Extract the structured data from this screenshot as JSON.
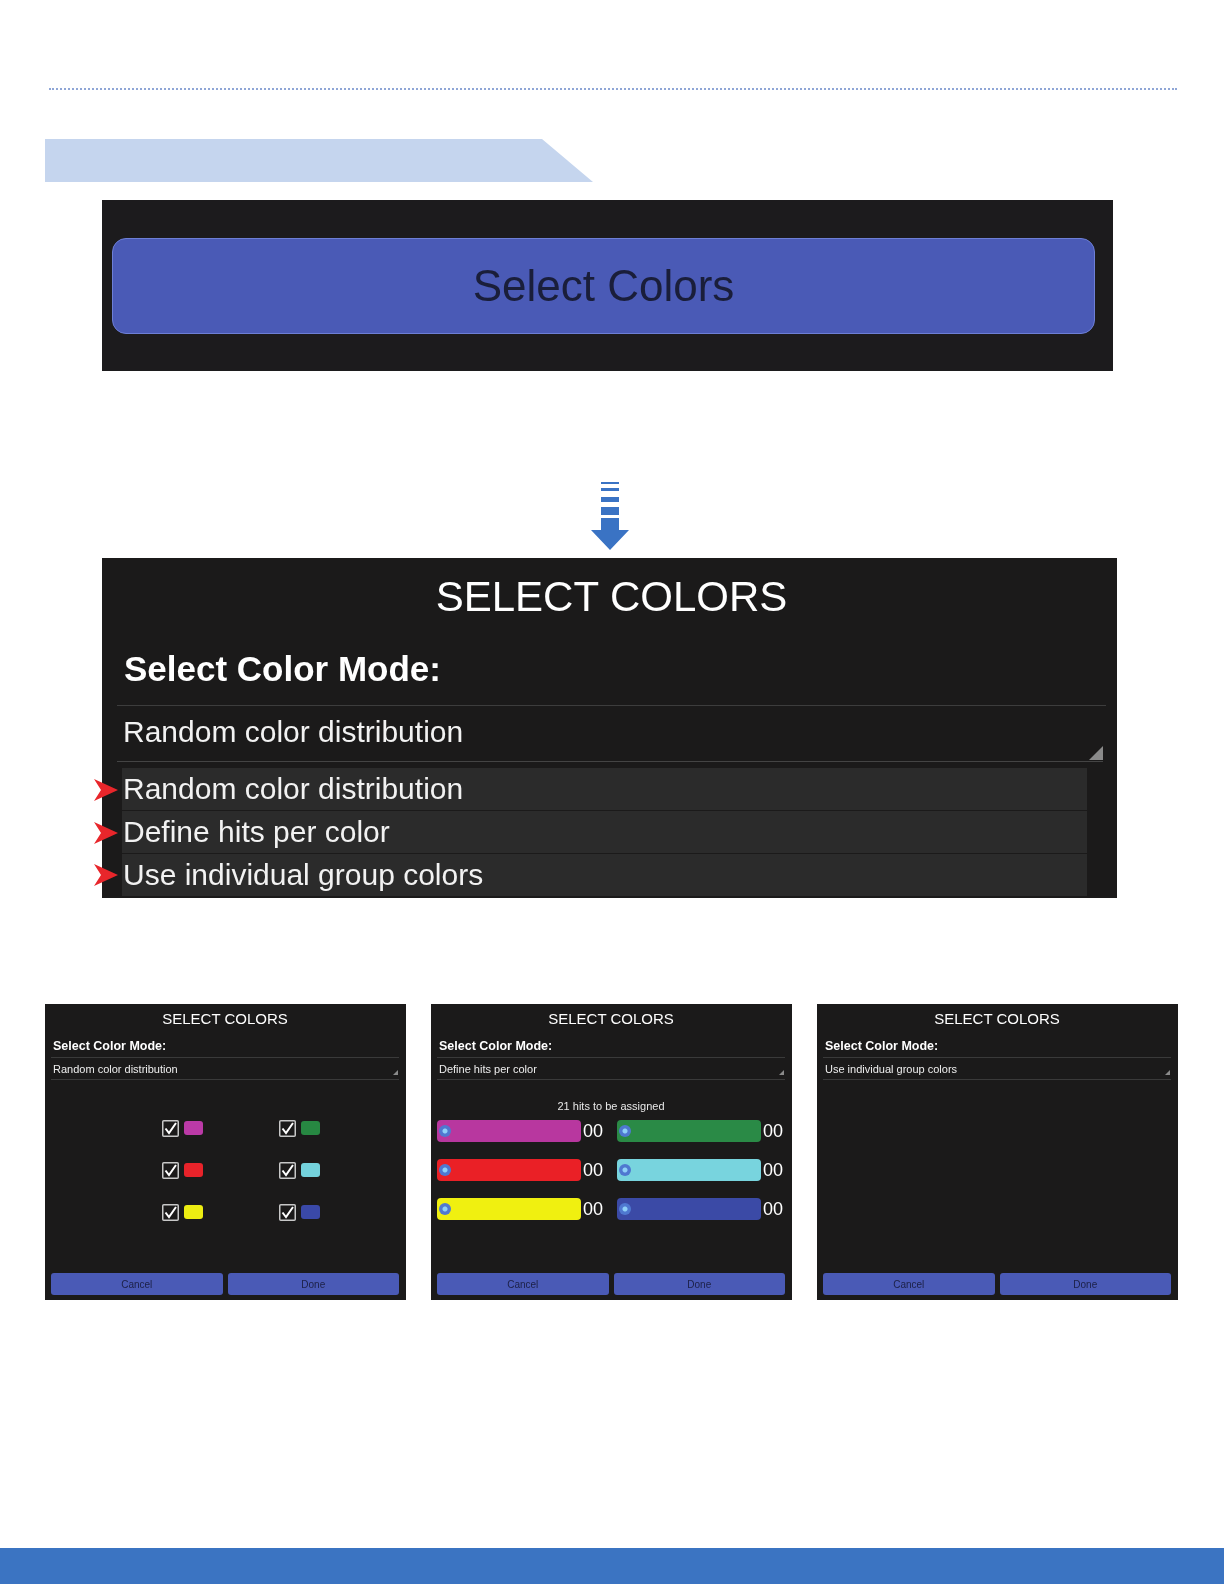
{
  "button_preview": {
    "label": "Select Colors"
  },
  "dialog_preview": {
    "title": "SELECT COLORS",
    "mode_label": "Select Color Mode:",
    "mode_value": "Random color distribution",
    "options": [
      {
        "label": "Random color distribution"
      },
      {
        "label": "Define hits per color"
      },
      {
        "label": "Use individual group colors"
      }
    ]
  },
  "mode_screens": [
    {
      "kind": "checkboxes",
      "title": "SELECT COLORS",
      "mode_label": "Select Color Mode:",
      "mode_value": "Random color distribution",
      "colors": [
        {
          "color": "#bb3aa7",
          "checked": true
        },
        {
          "color": "#278842",
          "checked": true
        },
        {
          "color": "#e8232a",
          "checked": true
        },
        {
          "color": "#74d2dc",
          "checked": true
        },
        {
          "color": "#eded12",
          "checked": true
        },
        {
          "color": "#3a49a8",
          "checked": true
        }
      ],
      "buttons": [
        "Cancel",
        "Done"
      ]
    },
    {
      "kind": "sliders",
      "title": "SELECT COLORS",
      "mode_label": "Select Color Mode:",
      "mode_value": "Define hits per color",
      "hint": "21 hits to be assigned",
      "sliders": [
        {
          "color": "#b8379f",
          "level": 0,
          "reading": "00"
        },
        {
          "color": "#2a8a46",
          "level": 0,
          "reading": "00"
        },
        {
          "color": "#ea2026",
          "level": 0,
          "reading": "00"
        },
        {
          "color": "#78d4de",
          "level": 0,
          "reading": "00"
        },
        {
          "color": "#f0f010",
          "level": 0,
          "reading": "00"
        },
        {
          "color": "#3b4aa6",
          "level": 0,
          "reading": "00"
        }
      ],
      "buttons": [
        "Cancel",
        "Done"
      ]
    },
    {
      "kind": "empty",
      "title": "SELECT COLORS",
      "mode_label": "Select Color Mode:",
      "mode_value": "Use individual group colors",
      "buttons": [
        "Cancel",
        "Done"
      ]
    }
  ]
}
